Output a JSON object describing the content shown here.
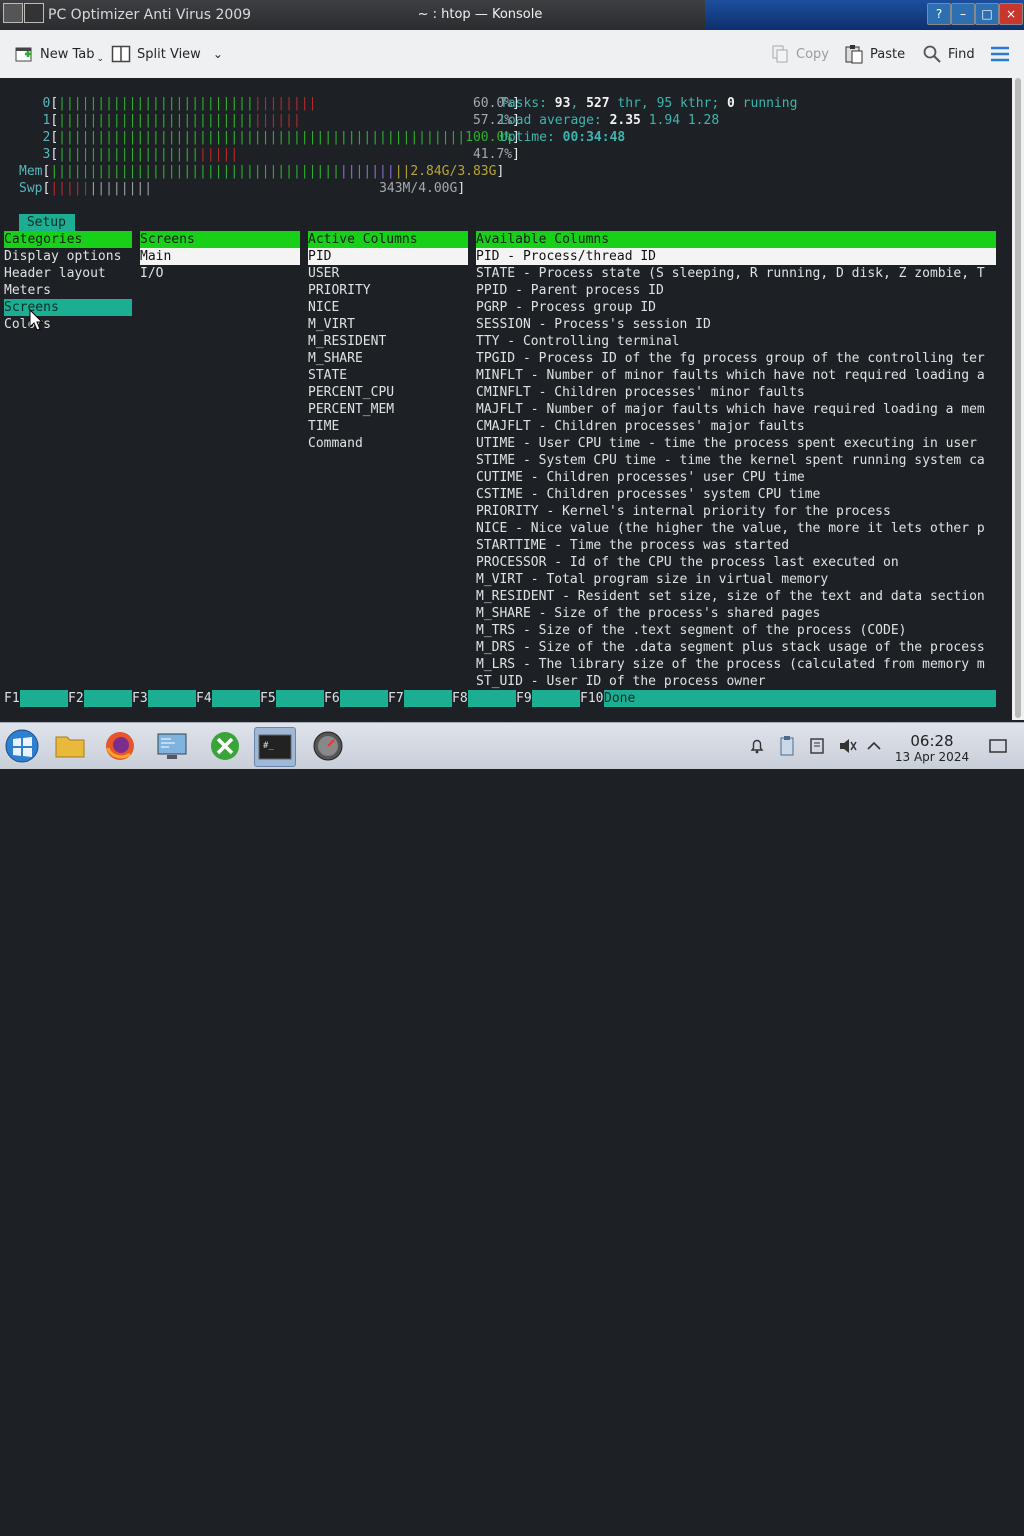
{
  "window": {
    "background_title": "PC Optimizer Anti Virus 2009",
    "title": "~ : htop — Konsole"
  },
  "toolbar": {
    "new_tab": "New Tab",
    "split_view": "Split View",
    "copy": "Copy",
    "paste": "Paste",
    "find": "Find"
  },
  "meters": [
    {
      "label": "0",
      "value": "60.0%"
    },
    {
      "label": "1",
      "value": "57.2%"
    },
    {
      "label": "2",
      "value": "100.0%"
    },
    {
      "label": "3",
      "value": "41.7%"
    },
    {
      "label": "Mem",
      "value": "2.84G/3.83G"
    },
    {
      "label": "Swp",
      "value": "343M/4.00G"
    }
  ],
  "summary": {
    "tasks_label": "Tasks: ",
    "tasks": "93",
    "thr": "527",
    "thr_label": " thr, ",
    "kthr": "95",
    "kthr_label": " kthr; ",
    "running": "0",
    "running_label": " running",
    "load_label": "Load average: ",
    "load1": "2.35",
    "load5": "1.94",
    "load15": "1.28",
    "uptime_label": "Uptime: ",
    "uptime": "00:34:48"
  },
  "setup": {
    "tab": "Setup",
    "categories_header": "Categories",
    "categories": [
      "Display options",
      "Header layout",
      "Meters",
      "Screens",
      "Colors"
    ],
    "screens_header": "Screens",
    "screens": [
      "Main",
      "I/O"
    ],
    "active_header": "Active Columns",
    "active": [
      "PID",
      "USER",
      "PRIORITY",
      "NICE",
      "M_VIRT",
      "M_RESIDENT",
      "M_SHARE",
      "STATE",
      "PERCENT_CPU",
      "PERCENT_MEM",
      "TIME",
      "Command"
    ],
    "available_header": "Available Columns",
    "available": [
      "PID - Process/thread ID",
      "STATE - Process state (S sleeping, R running, D disk, Z zombie, T",
      "PPID - Parent process ID",
      "PGRP - Process group ID",
      "SESSION - Process's session ID",
      "TTY - Controlling terminal",
      "TPGID - Process ID of the fg process group of the controlling ter",
      "MINFLT - Number of minor faults which have not required loading a",
      "CMINFLT - Children processes' minor faults",
      "MAJFLT - Number of major faults which have required loading a mem",
      "CMAJFLT - Children processes' major faults",
      "UTIME - User CPU time - time the process spent executing in user",
      "STIME - System CPU time - time the kernel spent running system ca",
      "CUTIME - Children processes' user CPU time",
      "CSTIME - Children processes' system CPU time",
      "PRIORITY - Kernel's internal priority for the process",
      "NICE - Nice value (the higher the value, the more it lets other p",
      "STARTTIME - Time the process was started",
      "PROCESSOR - Id of the CPU the process last executed on",
      "M_VIRT - Total program size in virtual memory",
      "M_RESIDENT - Resident set size, size of the text and data section",
      "M_SHARE - Size of the process's shared pages",
      "M_TRS - Size of the .text segment of the process (CODE)",
      "M_DRS - Size of the .data segment plus stack usage of the process",
      "M_LRS - The library size of the process (calculated from memory m",
      "ST_UID - User ID of the process owner"
    ]
  },
  "fkeys": [
    "F1",
    "F2",
    "F3",
    "F4",
    "F5",
    "F6",
    "F7",
    "F8",
    "F9",
    "F10"
  ],
  "fkey_done": "Done",
  "taskbar": {
    "time": "06:28",
    "date": "13 Apr 2024"
  }
}
